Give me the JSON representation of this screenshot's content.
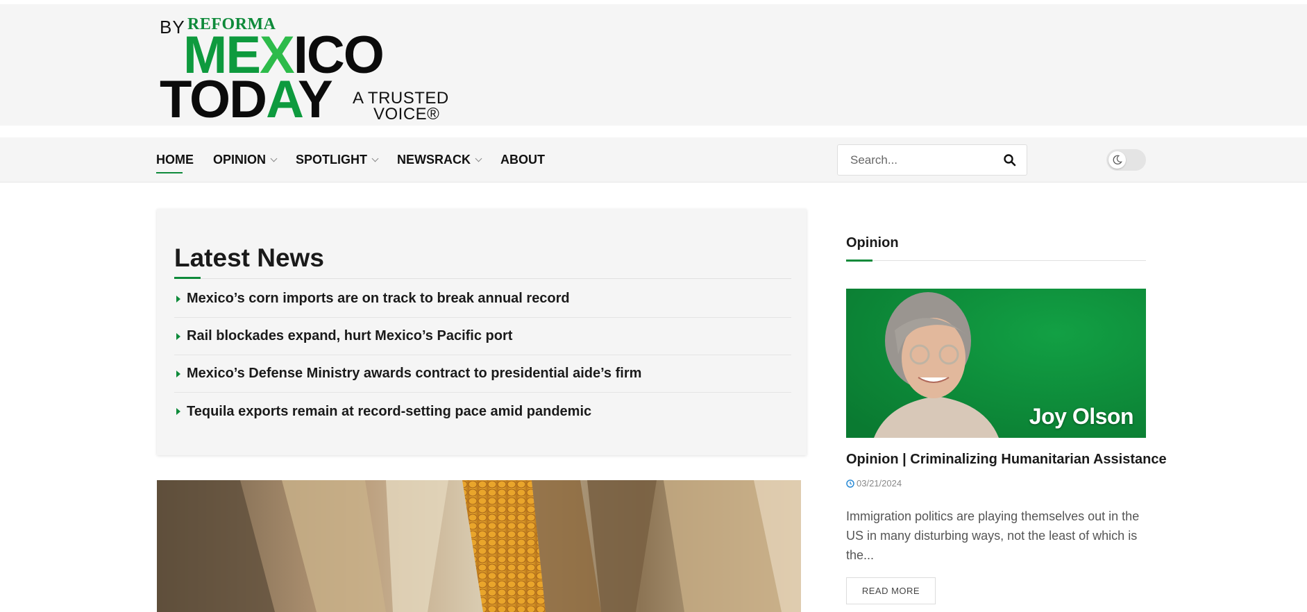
{
  "logo": {
    "by": "BY",
    "reforma": "REFORMA",
    "mexico_1": "M",
    "mexico_2": "E",
    "mexico_3": "X",
    "mexico_4": "ICO",
    "today_1": "TOD",
    "today_2": "A",
    "today_3": "Y",
    "trusted_1": "A TRUSTED",
    "trusted_2": "VOICE®"
  },
  "nav": {
    "items": [
      {
        "label": "HOME"
      },
      {
        "label": "OPINION"
      },
      {
        "label": "SPOTLIGHT"
      },
      {
        "label": "NEWSRACK"
      },
      {
        "label": "ABOUT"
      }
    ]
  },
  "search": {
    "placeholder": "Search..."
  },
  "latest": {
    "heading": "Latest News",
    "items": [
      "Mexico’s corn imports are on track to break annual record",
      "Rail blockades expand, hurt Mexico’s Pacific port",
      "Mexico’s Defense Ministry awards contract to presidential aide’s firm",
      "Tequila exports remain at record-setting pace amid pandemic"
    ]
  },
  "sidebar": {
    "title": "Opinion",
    "photo_name": "Joy Olson",
    "post_title": "Opinion | Criminalizing Humanitarian Assistance",
    "date": "03/21/2024",
    "excerpt": "Immigration politics are playing themselves out in the US in many disturbing ways, not the least of which is the...",
    "read_more": "READ MORE"
  },
  "colors": {
    "accent": "#0e8a3a",
    "header_bg": "#f5f5f5",
    "date_icon": "#2a8bd6"
  }
}
